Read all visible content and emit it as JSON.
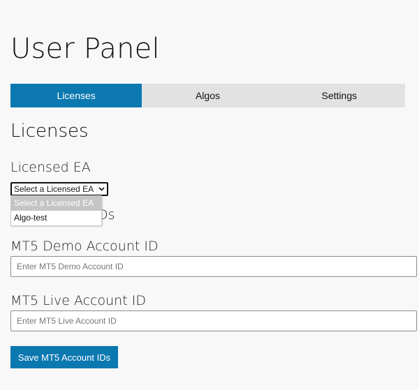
{
  "page": {
    "title": "User Panel"
  },
  "tabs": [
    {
      "label": "Licenses",
      "active": true
    },
    {
      "label": "Algos",
      "active": false
    },
    {
      "label": "Settings",
      "active": false
    }
  ],
  "licenses": {
    "section_title": "Licenses",
    "licensed_ea_label": "Licensed EA",
    "select": {
      "selected": "Select a Licensed EA",
      "options": [
        "Select a Licensed EA",
        "Algo-test"
      ]
    },
    "occluded_heading_fragment": "Ds",
    "demo": {
      "label": "MT5 Demo Account ID",
      "placeholder": "Enter MT5 Demo Account ID",
      "value": ""
    },
    "live": {
      "label": "MT5 Live Account ID",
      "placeholder": "Enter MT5 Live Account ID",
      "value": ""
    },
    "save_label": "Save MT5 Account IDs"
  },
  "colors": {
    "accent": "#0b78b0",
    "tab_bar": "#e2e2e2",
    "background": "#f8f8f8",
    "option_highlight": "#c5c5c5"
  },
  "icons": {
    "select_chevron": "chevron-down-icon"
  }
}
